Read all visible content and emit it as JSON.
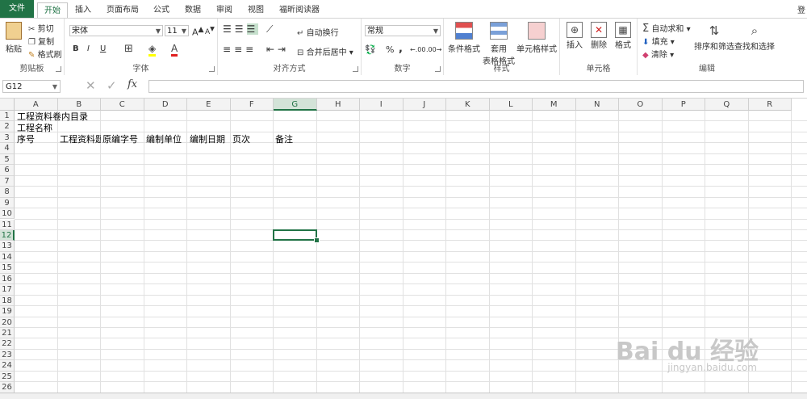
{
  "tabs": {
    "file": "文件",
    "home": "开始",
    "insert": "插入",
    "layout": "页面布局",
    "formulas": "公式",
    "data": "数据",
    "review": "审阅",
    "view": "视图",
    "reader": "福昕阅读器",
    "signin": "登"
  },
  "ribbon": {
    "clipboard": {
      "label": "剪贴板",
      "paste": "粘贴",
      "cut": "剪切",
      "copy": "复制",
      "format_painter": "格式刷"
    },
    "font": {
      "label": "字体",
      "name": "宋体",
      "size": "11",
      "bold": "B",
      "italic": "I",
      "underline": "U",
      "grow": "A",
      "shrink": "A"
    },
    "alignment": {
      "label": "对齐方式",
      "wrap": "自动换行",
      "merge": "合并后居中"
    },
    "number": {
      "label": "数字",
      "format": "常规",
      "percent": "%",
      "comma": ",",
      "inc": ".00",
      "dec": ".00"
    },
    "styles": {
      "label": "样式",
      "conditional": "条件格式",
      "table1": "套用",
      "table2": "表格格式",
      "cell_styles": "单元格样式"
    },
    "cells": {
      "label": "单元格",
      "insert": "插入",
      "delete": "删除",
      "format": "格式"
    },
    "editing": {
      "label": "编辑",
      "autosum": "自动求和",
      "fill": "填充",
      "clear": "清除",
      "sort": "排序和筛选",
      "find": "查找和选择"
    }
  },
  "formula_bar": {
    "name_box": "G12",
    "fx": "fx",
    "content": ""
  },
  "columns": [
    "A",
    "B",
    "C",
    "D",
    "E",
    "F",
    "G",
    "H",
    "I",
    "J",
    "K",
    "L",
    "M",
    "N",
    "O",
    "P",
    "Q",
    "R"
  ],
  "selected_column": "G",
  "rows": [
    "1",
    "2",
    "3",
    "4",
    "5",
    "6",
    "7",
    "8",
    "9",
    "10",
    "11",
    "12",
    "13",
    "14",
    "15",
    "16",
    "17",
    "18",
    "19",
    "20",
    "21",
    "22",
    "23",
    "24",
    "25",
    "26"
  ],
  "selected_row": "12",
  "cells": {
    "A1": "工程资料卷内目录",
    "A2": "工程名称",
    "A3": "序号",
    "B3": "工程资料题名",
    "C3": "原编字号",
    "D3": "编制单位",
    "E3": "编制日期",
    "F3": "页次",
    "G3": "备注"
  },
  "watermark": {
    "main": "Bai du 经验",
    "sub": "jingyan.baidu.com"
  }
}
